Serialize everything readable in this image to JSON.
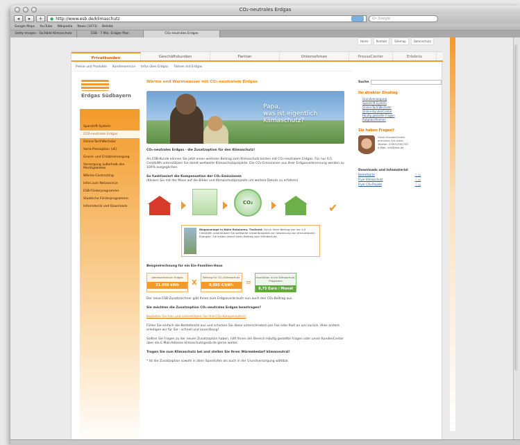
{
  "window": {
    "title": "CO₂-neutrales Erdgas"
  },
  "toolbar": {
    "url": "http://www.esb.de/klimaschutz",
    "search_placeholder": "Q• Google",
    "back": "◂",
    "forward": "▸",
    "add": "+"
  },
  "bookmarks": [
    "Google Maps",
    "YouTube",
    "Wikipedia",
    "News (1473)",
    "Beliebt"
  ],
  "tabs": [
    "Getty Images - Fachbild Klimaschutz",
    "ESB - 7 Mio. Erdgas Plan",
    "CO₂-neutrales Erdgas"
  ],
  "topright": [
    "Home",
    "Kontakt",
    "Sitemap",
    "Datenschutz"
  ],
  "nav": {
    "tabs": [
      "Privatkunden",
      "Geschäftskunden",
      "Partner",
      "Unternehmen"
    ],
    "side": [
      "PresseCenter",
      "Erlebnis"
    ]
  },
  "subnav": [
    "Preise und Produkte",
    "Kundenservice",
    "Infos über Erdgas",
    "Fahren mit Erdgas"
  ],
  "logo": {
    "name": "Erdgas Südbayern"
  },
  "sidemenu": [
    "Sparstrift-System",
    "CO2-neutrales Erdgas",
    "Online-Tarif-Wechsler",
    "Vario-Preisoption (vE)",
    "Grund- und Ersatzversorgung",
    "Versorgung außerhalb des Marktgebietes",
    "Wärme-Contracting",
    "Infos zum Netzservice",
    "ESB-Förderprogramme",
    "Staatliche Förderprogramme",
    "Infomaterial und Downloads"
  ],
  "main": {
    "heading": "Wärme und Warmwasser mit CO₂-neutralem Erdgas",
    "hero_quote": [
      "Papa,",
      "was ist eigentlich",
      "Klimaschutz?"
    ],
    "sec1_title": "CO₂-neutrales Erdgas - die Zusatzoption für den Klimaschutz!",
    "sec1_text": "Als ESB-Kunde können Sie jetzt einen weiteren Beitrag zum Klimaschutz leisten mit CO₂-neutralem Erdgas. Für nur 0,5 Cent/kWh unterstützen Sie damit weltweite Klimaschutzprojekte. Die CO₂-Emissionen aus Ihrer Erdgasverbrennung werden zu 100% ausgeglichen.",
    "sec2_title": "So funktioniert die Kompensation der CO₂-Emissionen",
    "sec2_text": "(Klicken Sie mit der Maus auf die Bilder und Klimaschutzprojekte um weitere Details zu erfahren)",
    "co2_label": "CO₂",
    "infobox_title": "Biogasanlage in Nähe Ratskamu, Thailand:",
    "infobox_text": "Durch Ihren Beitrag von nur 0,5 Cent/kWh unterstützen Sie weltweite Umweltprojekte zur Gewinnung von erneuerbaren Energien. Sie leisten damit einen Beitrag zum Klimaschutz.",
    "calc_title": "Beispielrechnung für ein Ein-Familien-Haus",
    "calc": [
      {
        "label": "Jahresverbrauch Erdgas",
        "value": "21.000 kWh"
      },
      {
        "label": "Beitrag für CO₂-Klimaschutz",
        "value": "0,005 €/kWh"
      },
      {
        "label": "Investition in ein Klimaschutz-Programm",
        "value": "8,75 Euro / Monat"
      }
    ],
    "calc_ops": [
      "X",
      "="
    ],
    "sec3_text": "Der neue ESB-Zusatzrechner gibt Ihnen zum Erdgasverbrauch nun auch den CO₂-Beitrag aus.",
    "sec4_title": "Sie möchten die Zusatzoption CO₂-neutrales Erdgas beantragen?",
    "sec4_link": "Bestellen Sie hier und unterstützen Sie Ihre CO₂-Kompensation!",
    "sec4_text": "Füllen Sie einfach die Bestellkarte aus und schicken Sie diese unterschrieben per Fax oder Post an uns zurück. Alles andere erledigen wir für Sie - schnell und zuverlässig!",
    "sec5_text": "Sollten Sie Fragen zu der neuen Zusatzoption haben, hilft Ihnen der Bereich Häufig gestellte Fragen oder unser KundenCenter über die E-Mail-Adresse klimaschutz@esb.de gerne weiter.",
    "sec6_title": "Tragen Sie zum Klimaschutz bei und stellen Sie Ihren Wärmebedarf klimaneutral!",
    "footnote": "* Ist die Zusatzoption sowohl in allen Sparstufen als auch in der Grundversorgung wählbar."
  },
  "right": {
    "search_label": "Suche",
    "links_title": "Ihr direkter Einstieg",
    "links": [
      "Grundversorgung",
      "Sparstrift-System",
      "Online-Tarif-Wechsler",
      "Online-KundenCenter",
      "Häufig gestellte Fragen",
      "Ratgeberthemen"
    ],
    "contact_title": "Sie haben Fragen?",
    "contact_text": [
      "Unser KundenCenter",
      "erreichen Sie unter:",
      "Telefon: 01801/300700",
      "e-Mail: info@esb.de"
    ],
    "downloads_title": "Downloads und Infomaterial",
    "downloads": [
      "Bestellkarte",
      "Flyer Klimaschutz",
      "Flyer CO₂-Projekt"
    ]
  }
}
